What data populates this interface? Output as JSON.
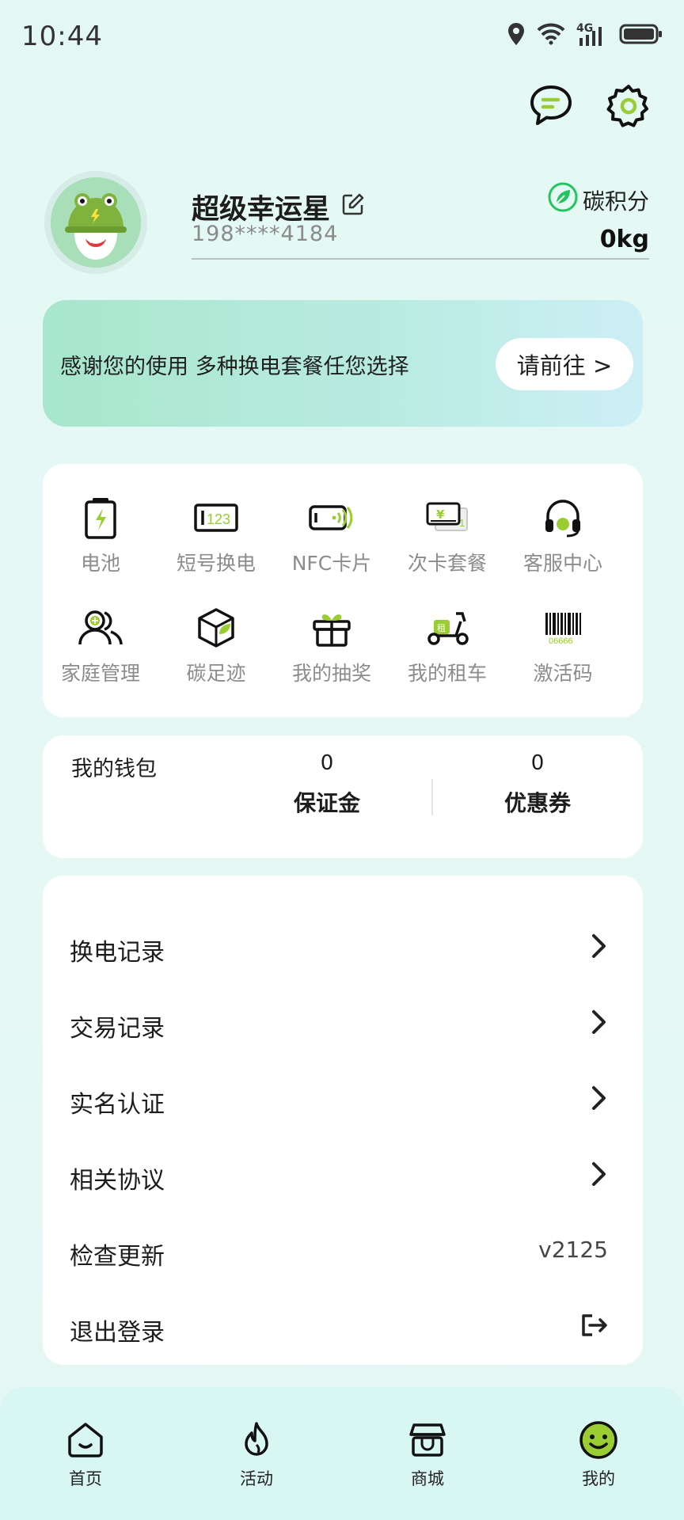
{
  "status_bar": {
    "time": "10:44",
    "network": "4G"
  },
  "profile": {
    "name": "超级幸运星",
    "phone": "198****4184",
    "carbon_title": "碳积分",
    "carbon_value": "0kg"
  },
  "banner": {
    "text": "感谢您的使用 多种换电套餐任您选择",
    "button": "请前往 >"
  },
  "services": [
    {
      "label": "电池",
      "icon": "battery-icon"
    },
    {
      "label": "短号换电",
      "icon": "short-code-icon"
    },
    {
      "label": "NFC卡片",
      "icon": "nfc-card-icon"
    },
    {
      "label": "次卡套餐",
      "icon": "ticket-package-icon"
    },
    {
      "label": "客服中心",
      "icon": "headset-icon"
    },
    {
      "label": "家庭管理",
      "icon": "family-icon"
    },
    {
      "label": "碳足迹",
      "icon": "carbon-footprint-icon"
    },
    {
      "label": "我的抽奖",
      "icon": "gift-icon"
    },
    {
      "label": "我的租车",
      "icon": "scooter-icon"
    },
    {
      "label": "激活码",
      "icon": "barcode-icon"
    }
  ],
  "barcode_digits": "06666",
  "wallet": {
    "title": "我的钱包",
    "deposit_value": "0",
    "deposit_label": "保证金",
    "coupon_value": "0",
    "coupon_label": "优惠券"
  },
  "menu": [
    {
      "label": "换电记录"
    },
    {
      "label": "交易记录"
    },
    {
      "label": "实名认证"
    },
    {
      "label": "相关协议"
    },
    {
      "label": "检查更新",
      "value": "v2125"
    },
    {
      "label": "退出登录"
    }
  ],
  "nav": [
    {
      "label": "首页"
    },
    {
      "label": "活动"
    },
    {
      "label": "商城"
    },
    {
      "label": "我的"
    }
  ],
  "colors": {
    "accent": "#9acd32",
    "accent_green": "#22c55e",
    "background": "#e3f8f4"
  }
}
